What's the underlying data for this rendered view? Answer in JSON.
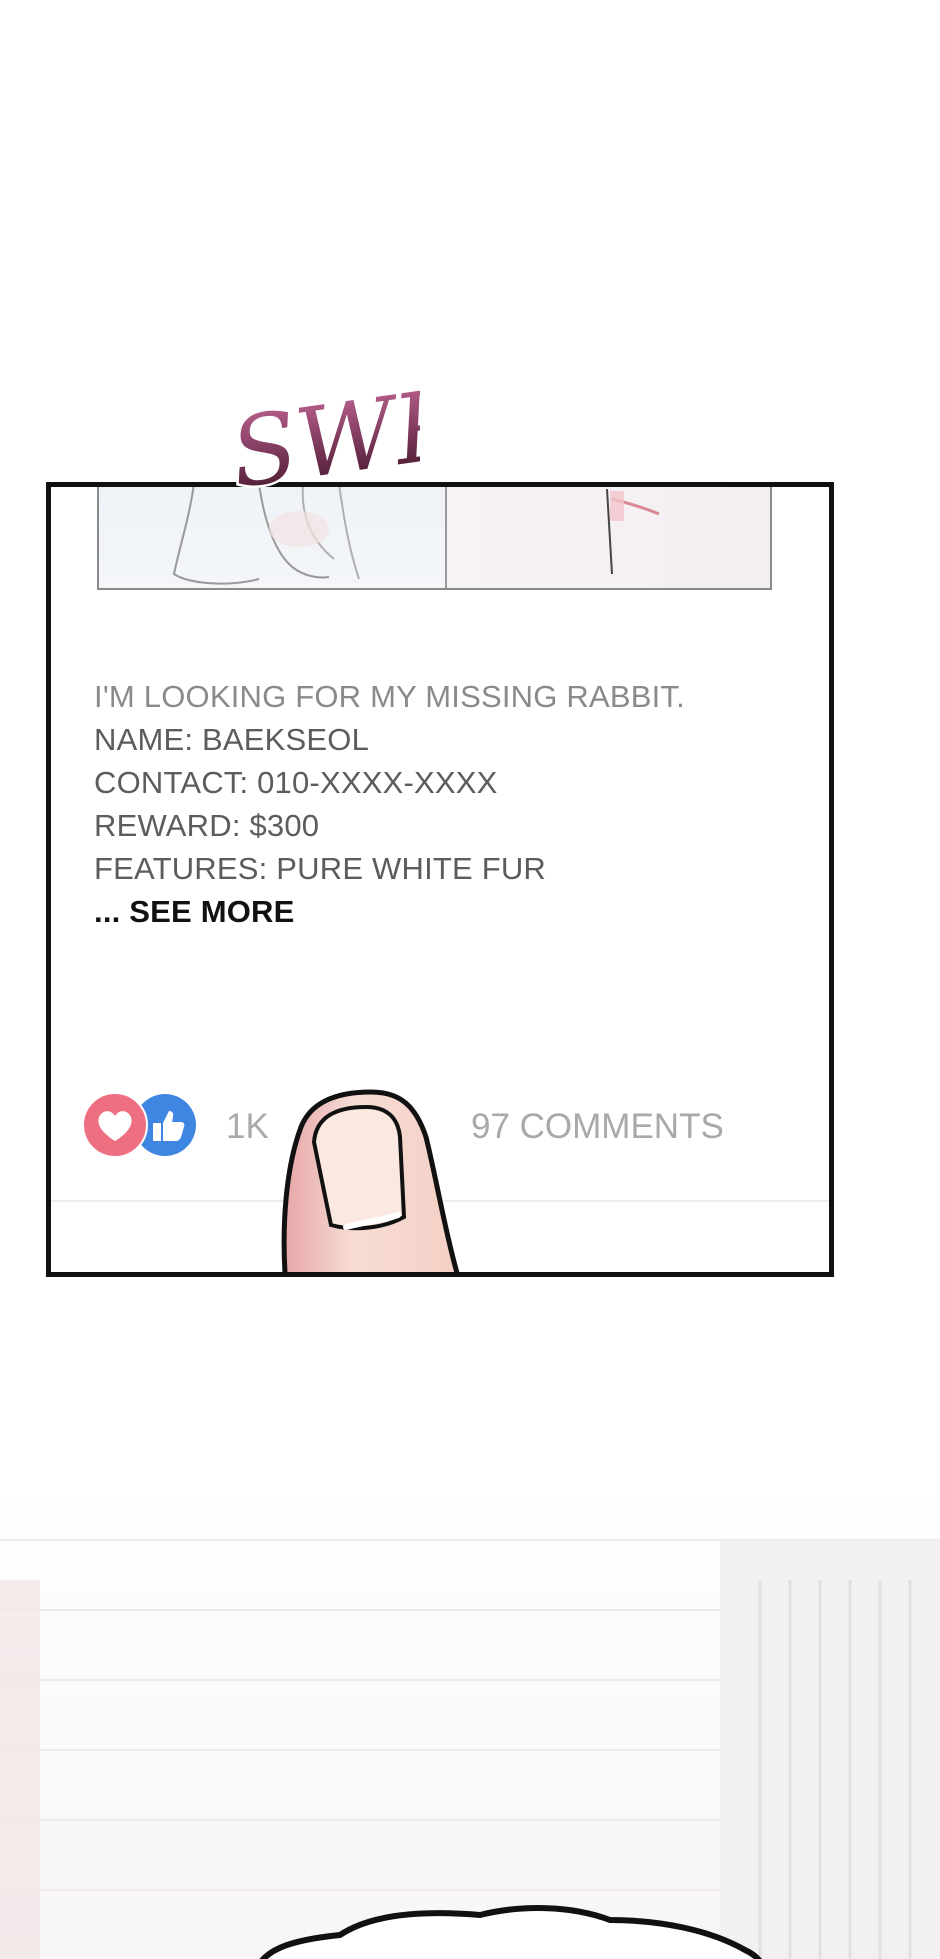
{
  "sfx": {
    "text": "SWP",
    "color": "#7a2a52"
  },
  "post": {
    "lines": [
      "I'M LOOKING FOR MY MISSING RABBIT.",
      "NAME: BAEKSEOL",
      "CONTACT: 010-XXXX-XXXX",
      "REWARD: $300",
      "FEATURES: PURE WHITE FUR"
    ],
    "see_more": "... SEE MORE"
  },
  "reactions": {
    "icons": [
      "heart-icon",
      "thumbs-up-icon"
    ],
    "count": "1K",
    "comments": "97 COMMENTS",
    "heart_color": "#ef6f82",
    "like_color": "#3f86e2"
  },
  "colors": {
    "panel_border": "#111111",
    "text": "#5c5c5c",
    "muted": "#a9a9a9"
  }
}
